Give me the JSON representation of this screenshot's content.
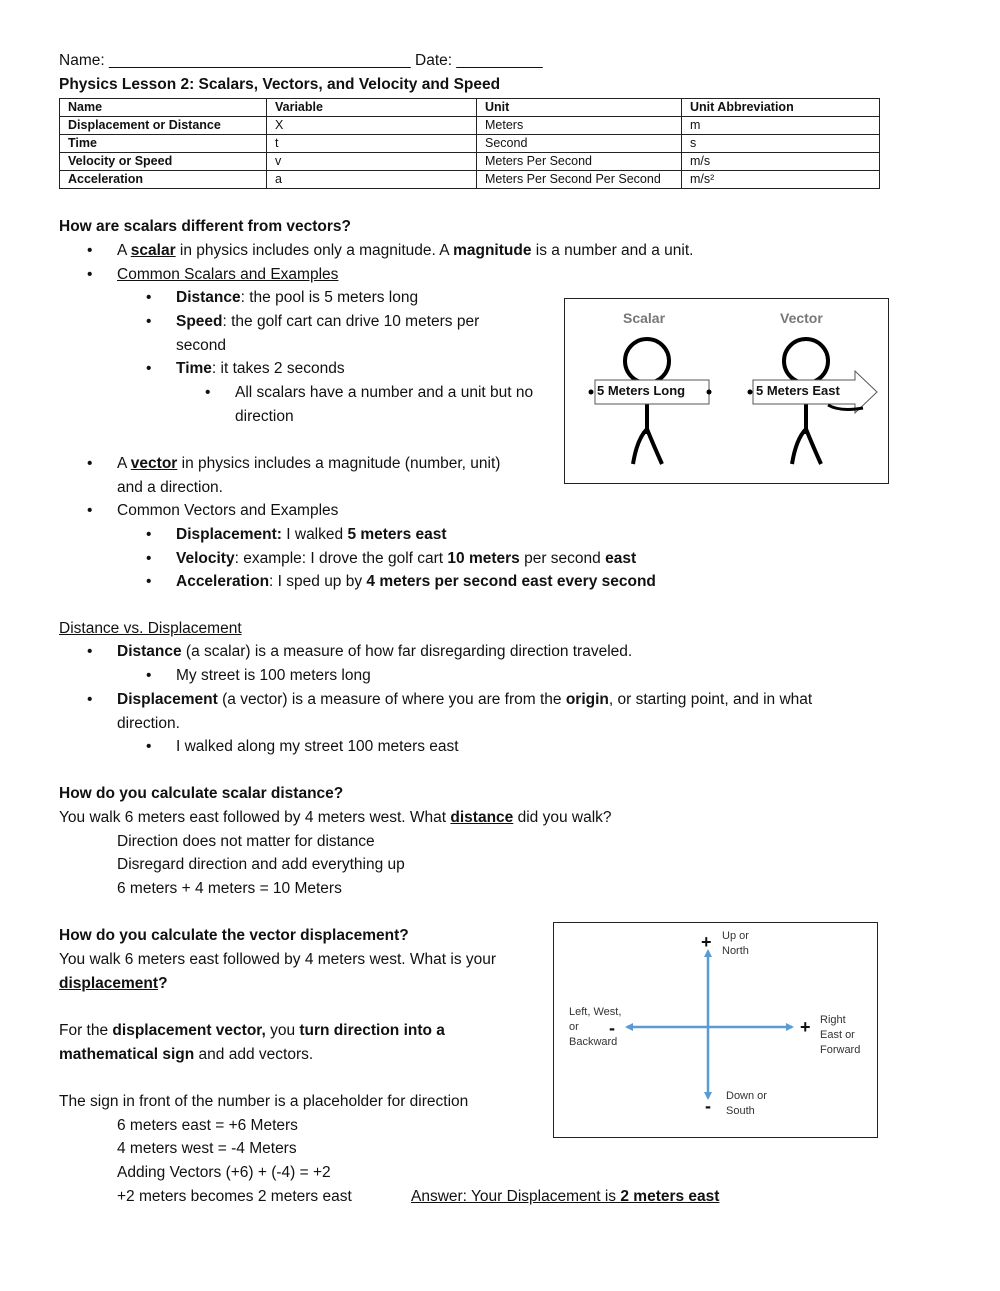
{
  "header": {
    "name_label": "Name:",
    "name_blank": "___________________________________",
    "date_label": "Date:",
    "date_blank": "__________",
    "title": "Physics Lesson 2: Scalars, Vectors, and Velocity and Speed"
  },
  "table": {
    "headers": [
      "Name",
      "Variable",
      "Unit",
      "Unit Abbreviation"
    ],
    "rows": [
      [
        "Displacement or Distance",
        "X",
        "Meters",
        "m"
      ],
      [
        "Time",
        "t",
        "Second",
        "s"
      ],
      [
        "Velocity or Speed",
        "v",
        "Meters Per Second",
        "m/s"
      ],
      [
        "Acceleration",
        "a",
        "Meters Per Second Per Second",
        "m/s²"
      ]
    ]
  },
  "scalars_vectors": {
    "heading": "How are scalars different from vectors?",
    "scalar_def": {
      "a": "A ",
      "term": "scalar",
      "rest1": " in physics includes only a magnitude.  A ",
      "term2": "magnitude",
      "rest2": " is a number and a unit."
    },
    "common_scalars": "Common Scalars and Examples",
    "scalar_examples": [
      {
        "term": "Distance",
        "text": ": the pool is 5 meters long"
      },
      {
        "term": "Speed",
        "text": ": the golf cart can drive 10 meters per",
        "text2": "second"
      },
      {
        "term": "Time",
        "text": ": it takes 2 seconds"
      }
    ],
    "scalar_note_1": "All scalars have a number and a unit but no",
    "scalar_note_2": "direction",
    "vector_def": {
      "a": "A ",
      "term": "vector",
      "rest1": " in physics includes a magnitude (number, unit)",
      "rest2": "and a direction."
    },
    "common_vectors": "Common Vectors and Examples",
    "vector_examples": [
      {
        "term": "Displacement:",
        "t1": "  I walked ",
        "b1": "5 meters east",
        "t2": "",
        "b2": ""
      },
      {
        "term": "Velocity",
        "t1": ": example: I drove the golf cart ",
        "b1": "10 meters",
        "t2": " per second ",
        "b2": "east"
      },
      {
        "term": "Acceleration",
        "t1": ": I sped up by ",
        "b1": "4 meters per second east every second",
        "t2": "",
        "b2": ""
      }
    ]
  },
  "figure_scalar_vector": {
    "scalar_title": "Scalar",
    "vector_title": "Vector",
    "scalar_sign": "5 Meters Long",
    "vector_sign": "5 Meters East"
  },
  "distance_displacement": {
    "heading": "Distance vs. Displacement",
    "distance": {
      "term": "Distance",
      "text": " (a scalar) is a measure of how far disregarding direction traveled."
    },
    "distance_example": "My street is 100 meters long",
    "displacement": {
      "term": "Displacement",
      "text1": " (a vector) is a measure of where you are from the ",
      "term2": "origin",
      "text2": ", or starting point, and in what",
      "text3": "direction."
    },
    "displacement_example": "I walked along my street 100 meters east"
  },
  "scalar_calc": {
    "heading": "How do you calculate scalar distance?",
    "question_a": "You walk 6 meters east followed by 4 meters west.  What ",
    "question_term": "distance",
    "question_b": " did you walk?",
    "steps": [
      "Direction does not matter for distance",
      "Disregard direction and add everything up",
      "6 meters + 4 meters = 10 Meters"
    ]
  },
  "vector_calc": {
    "heading": "How do you calculate the vector displacement?",
    "question_a": "You walk 6 meters east followed by 4 meters west.  What is your",
    "question_term": "displacement",
    "question_b": "?",
    "explain": {
      "t1": "For the ",
      "b1": "displacement vector,",
      "t2": " you ",
      "b2": "turn direction into a",
      "b3": "mathematical sign",
      "t3": " and add vectors."
    },
    "sign_note": "The sign in front of the number is a placeholder for direction",
    "steps": [
      "6 meters east = +6 Meters",
      "4 meters west = -4 Meters",
      "Adding Vectors (+6) + (-4) = +2",
      "+2 meters becomes 2 meters east"
    ],
    "answer_a": "Answer: Your Displacement is ",
    "answer_b": "2 meters east"
  },
  "figure_axes": {
    "up_sign": "+",
    "up_label_1": "Up or",
    "up_label_2": "North",
    "down_sign": "-",
    "down_label_1": "Down or",
    "down_label_2": "South",
    "left_sign": "-",
    "left_label_1": "Left, West,",
    "left_label_2": "or",
    "left_label_3": "Backward",
    "right_sign": "+",
    "right_label_1": "Right",
    "right_label_2": "East or",
    "right_label_3": "Forward",
    "arrow_color": "#5b9bd5"
  }
}
